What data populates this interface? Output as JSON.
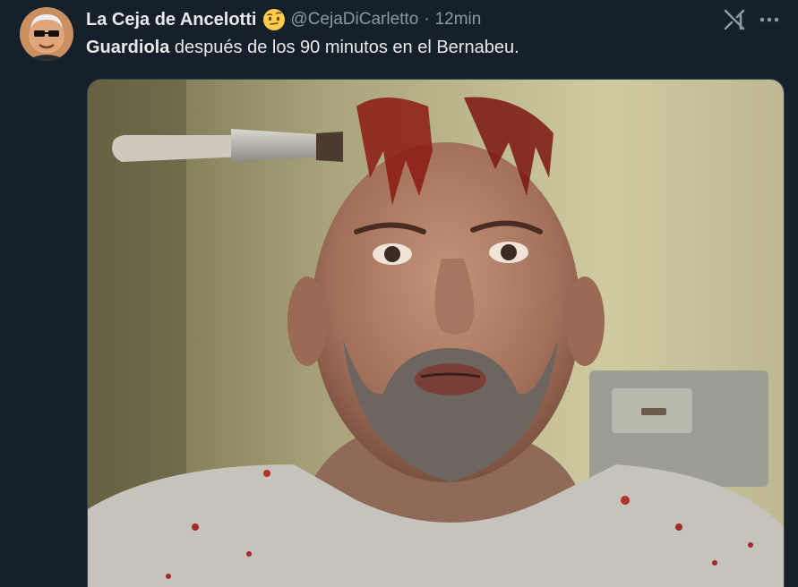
{
  "tweet": {
    "display_name": "La Ceja de Ancelotti",
    "name_emoji": "face-with-raised-eyebrow",
    "handle": "@CejaDiCarletto",
    "separator": "·",
    "timestamp": "12min",
    "text_bold": "Guardiola",
    "text_rest": " después de los 90 minutos en el Bernabeu."
  },
  "icons": {
    "grok": "grok-icon",
    "more": "more-icon"
  },
  "colors": {
    "background": "#15202b",
    "primary_text": "#e7e9ea",
    "secondary_text": "#8b98a5"
  }
}
